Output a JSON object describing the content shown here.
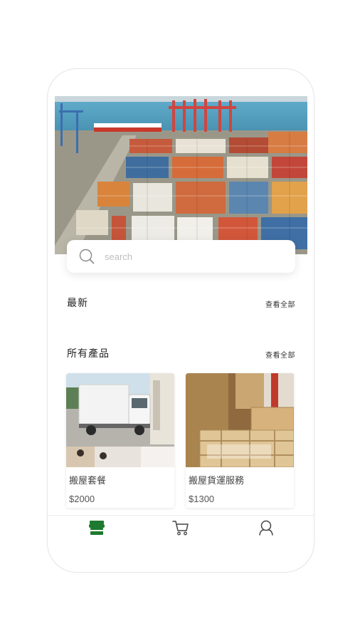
{
  "search": {
    "placeholder": "search"
  },
  "sections": {
    "latest": {
      "title": "最新",
      "see_all": "查看全部"
    },
    "all_products": {
      "title": "所有產品",
      "see_all": "查看全部"
    }
  },
  "products": [
    {
      "name": "搬屋套餐",
      "price": "$2000"
    },
    {
      "name": "搬屋貨運服務",
      "price": "$1300"
    }
  ],
  "bottom_nav": {
    "items": [
      {
        "icon": "store-icon",
        "active": true
      },
      {
        "icon": "cart-icon",
        "active": false
      },
      {
        "icon": "profile-icon",
        "active": false
      }
    ]
  },
  "colors": {
    "accent": "#1e7a2f",
    "nav_inactive": "#444444",
    "placeholder": "#bdbdbd"
  }
}
